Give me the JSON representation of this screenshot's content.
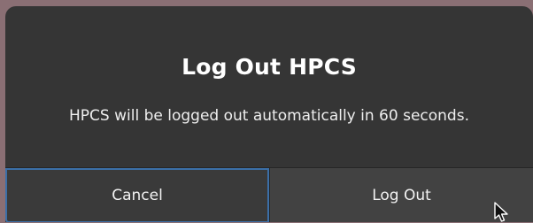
{
  "dialog": {
    "title": "Log Out HPCS",
    "message": "HPCS will be logged out automatically in 60 seconds.",
    "buttons": {
      "cancel_label": "Cancel",
      "logout_label": "Log Out"
    }
  },
  "colors": {
    "background": "#8a6f74",
    "dialog_bg": "#353535",
    "focus_ring": "#3b6fa8"
  },
  "icons": {
    "pointer": "mouse-pointer-icon"
  }
}
